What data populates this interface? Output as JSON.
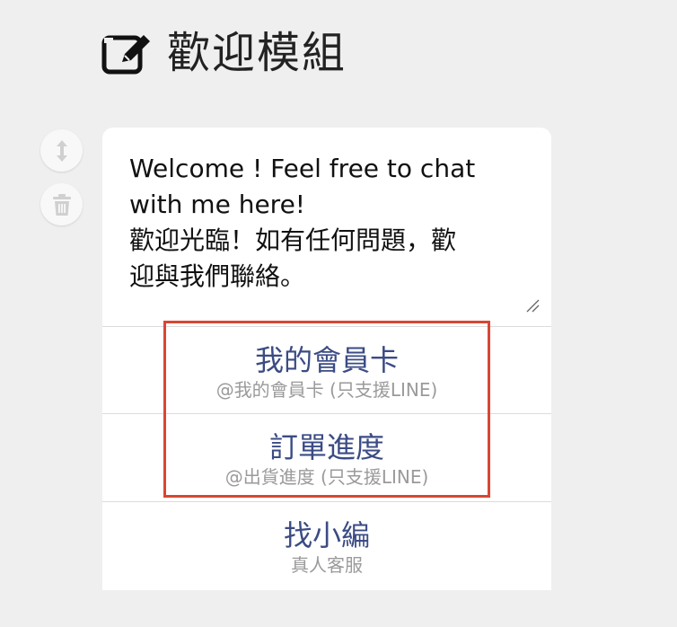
{
  "header": {
    "title": "歡迎模組",
    "icon": "edit-icon"
  },
  "side_actions": [
    {
      "icon": "move-vertical-icon"
    },
    {
      "icon": "trash-icon"
    }
  ],
  "card": {
    "message": "Welcome ! Feel free to chat\nwith me here!\n歡迎光臨！如有任何問題，歡\n迎與我們聯絡。",
    "options": [
      {
        "label": "我的會員卡",
        "sub": "@我的會員卡 (只支援LINE)"
      },
      {
        "label": "訂單進度",
        "sub": "@出貨進度 (只支援LINE)"
      },
      {
        "label": "找小編",
        "sub": "真人客服"
      }
    ]
  },
  "colors": {
    "option_label": "#3b4b84",
    "highlight": "#d94633",
    "background": "#efefef"
  }
}
